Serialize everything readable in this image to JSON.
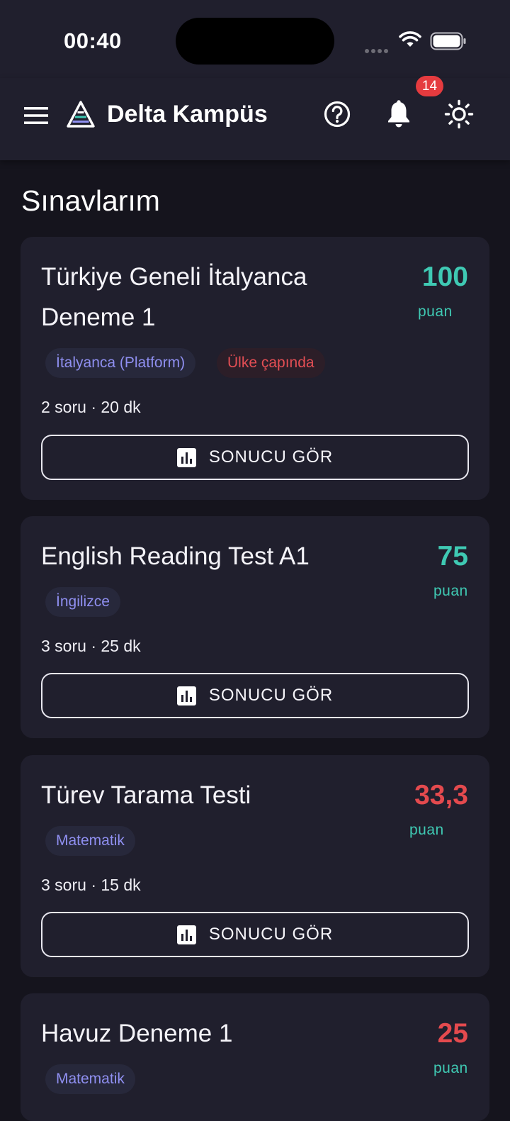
{
  "status_bar": {
    "time": "00:40"
  },
  "app_bar": {
    "title": "Delta Kampüs",
    "notification_count": "14",
    "icons": [
      "menu-icon",
      "delta-logo-icon",
      "help-icon",
      "bell-icon",
      "sun-icon"
    ]
  },
  "page": {
    "title": "Sınavlarım"
  },
  "colors": {
    "score_high": "#3fc9b3",
    "score_low": "#e44a4e",
    "chip_subject": "#8f8ff0",
    "chip_scope": "#e34e54",
    "badge": "#e53b3f"
  },
  "exams": [
    {
      "title": "Türkiye Geneli İtalyanca Deneme 1",
      "score": "100",
      "score_unit": "puan",
      "chips": [
        "İtalyanca (Platform)",
        "Ülke çapında"
      ],
      "meta": "2 soru · 20 dk",
      "button": "SONUCU GÖR"
    },
    {
      "title": "English Reading Test A1",
      "score": "75",
      "score_unit": "puan",
      "chips": [
        "İngilizce"
      ],
      "meta": "3 soru · 25 dk",
      "button": "SONUCU GÖR"
    },
    {
      "title": "Türev Tarama Testi",
      "score": "33,3",
      "score_unit": "puan",
      "chips": [
        "Matematik"
      ],
      "meta": "3 soru · 15 dk",
      "button": "SONUCU GÖR"
    },
    {
      "title": "Havuz Deneme 1",
      "score": "25",
      "score_unit": "puan",
      "chips": [
        "Matematik"
      ],
      "meta": "",
      "button": ""
    }
  ]
}
